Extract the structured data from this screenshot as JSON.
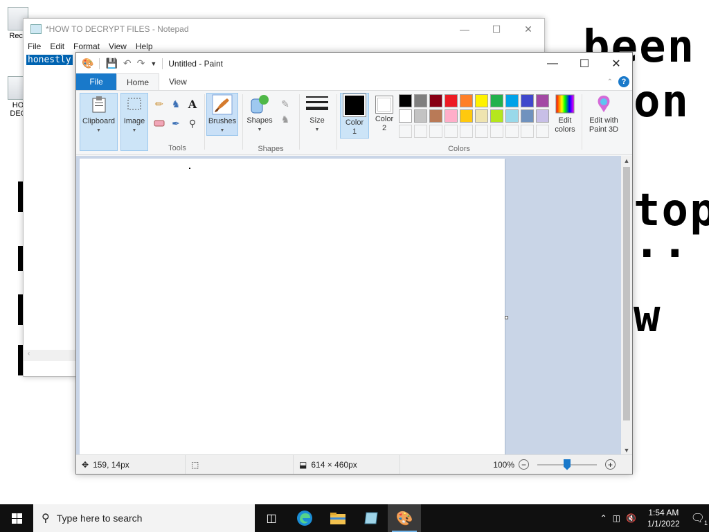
{
  "desktop": {
    "wall_lines": [
      "been",
      "on",
      "top",
      "..",
      "w"
    ],
    "icons": [
      {
        "label": "Recy"
      },
      {
        "label": "HO\nDEC"
      }
    ]
  },
  "notepad": {
    "title": "*HOW TO DECRYPT FILES - Notepad",
    "menus": [
      "File",
      "Edit",
      "Format",
      "View",
      "Help"
    ],
    "selected_text": "honestly"
  },
  "paint": {
    "title": "Untitled - Paint",
    "tabs": {
      "file": "File",
      "home": "Home",
      "view": "View"
    },
    "groups": {
      "clipboard": "Clipboard",
      "image": "Image",
      "tools": "Tools",
      "brushes": "Brushes",
      "shapes": "Shapes",
      "shapes_group": "Shapes",
      "size": "Size",
      "color1": "Color 1",
      "color2": "Color 2",
      "colors": "Colors",
      "edit_colors": "Edit colors",
      "edit_paint3d": "Edit with Paint 3D"
    },
    "palette_row1": [
      "#000000",
      "#7f7f7f",
      "#880015",
      "#ed1c24",
      "#ff7f27",
      "#fff200",
      "#22b14c",
      "#00a2e8",
      "#3f48cc",
      "#a349a4"
    ],
    "palette_row2": [
      "#ffffff",
      "#c3c3c3",
      "#b97a57",
      "#ffaec9",
      "#ffc90e",
      "#efe4b0",
      "#b5e61d",
      "#99d9ea",
      "#7092be",
      "#c8bfe7"
    ],
    "color1_value": "#000000",
    "color2_value": "#ffffff",
    "status": {
      "cursor_pos": "159, 14px",
      "canvas_size": "614 × 460px",
      "zoom": "100%",
      "zoom_out": "−",
      "zoom_in": "+"
    }
  },
  "taskbar": {
    "search_placeholder": "Type here to search",
    "time": "1:54 AM",
    "date": "1/1/2022",
    "notification_count": "1"
  }
}
